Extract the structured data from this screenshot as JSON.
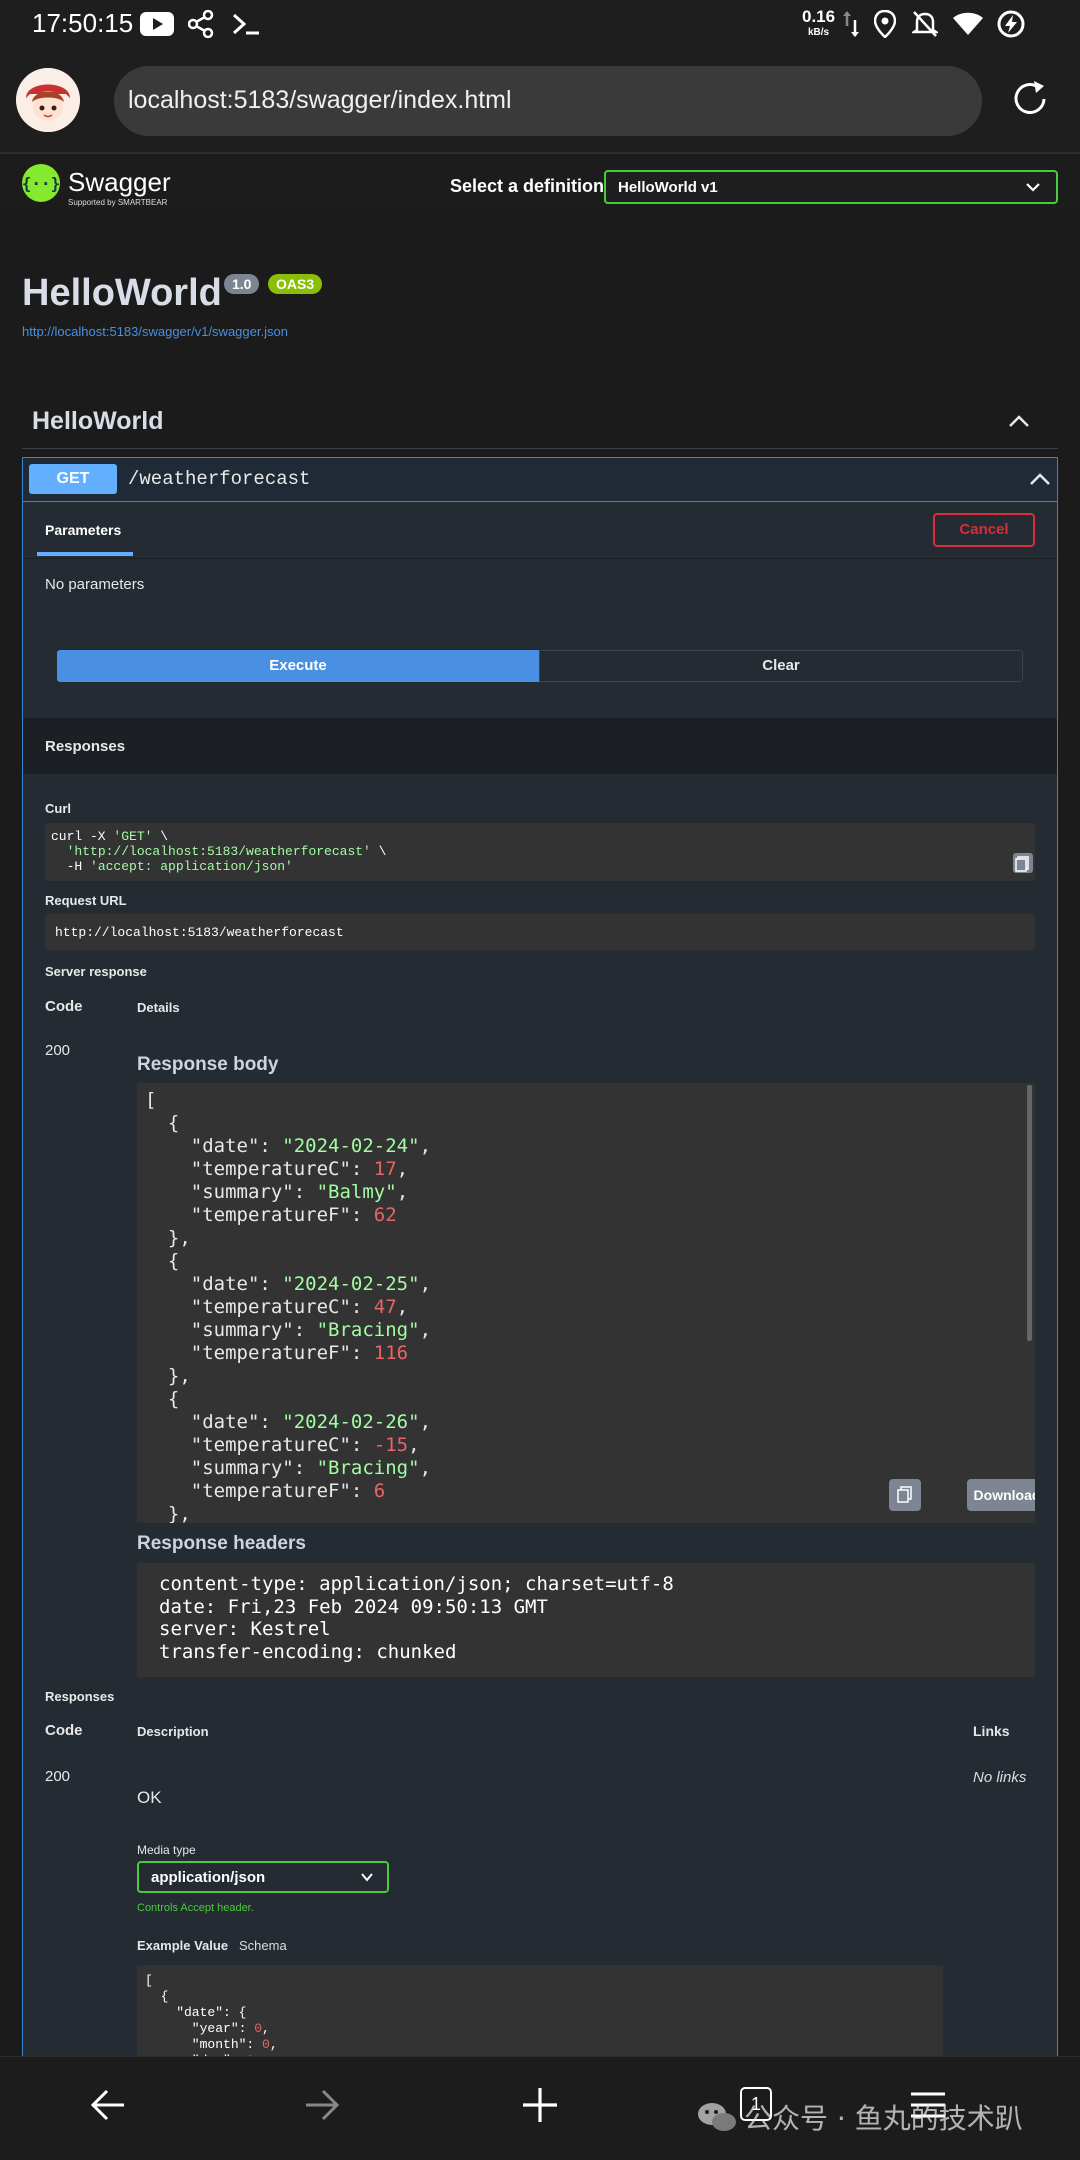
{
  "status": {
    "time": "17:50:15",
    "net_speed": "0.16",
    "net_unit": "kB/s"
  },
  "browser": {
    "url": "localhost:5183/swagger/index.html"
  },
  "swagger": {
    "brand": "Swagger",
    "brand_sub": "Supported by SMARTBEAR",
    "select_label": "Select a definition",
    "selected_definition": "HelloWorld v1",
    "title": "HelloWorld",
    "version_badge": "1.0",
    "oas_badge": "OAS3",
    "spec_link": "http://localhost:5183/swagger/v1/swagger.json",
    "section_title": "HelloWorld"
  },
  "operation": {
    "method": "GET",
    "path": "/weatherforecast",
    "params_tab": "Parameters",
    "cancel": "Cancel",
    "no_params": "No parameters",
    "execute": "Execute",
    "clear": "Clear",
    "responses_header": "Responses",
    "curl_label": "Curl",
    "curl_line1_a": "curl -X ",
    "curl_line1_b": "'GET'",
    "curl_line1_c": " \\",
    "curl_line2": "'http://localhost:5183/weatherforecast'",
    "curl_line2_c": " \\",
    "curl_line3_a": "-H ",
    "curl_line3_b": "'accept: application/json'",
    "request_url_label": "Request URL",
    "request_url": "http://localhost:5183/weatherforecast",
    "server_response_label": "Server response",
    "code_col": "Code",
    "details_col": "Details",
    "code_value": "200",
    "response_body_label": "Response body",
    "download": "Download",
    "response_headers_label": "Response headers",
    "headers": [
      "content-type: application/json; charset=utf-8",
      "date: Fri,23 Feb 2024 09:50:13 GMT",
      "server: Kestrel",
      "transfer-encoding: chunked"
    ],
    "responses_label2": "Responses",
    "code_col2": "Code",
    "description_col": "Description",
    "links_col": "Links",
    "code_value2": "200",
    "no_links": "No links",
    "ok": "OK",
    "media_type_label": "Media type",
    "media_type": "application/json",
    "controls_accept": "Controls Accept header.",
    "example_value_tab": "Example Value",
    "schema_tab": "Schema"
  },
  "response_body": [
    {
      "date": "2024-02-24",
      "temperatureC": "17",
      "summary": "Balmy",
      "temperatureF": "62"
    },
    {
      "date": "2024-02-25",
      "temperatureC": "47",
      "summary": "Bracing",
      "temperatureF": "116"
    },
    {
      "date": "2024-02-26",
      "temperatureC": "-15",
      "summary": "Bracing",
      "temperatureF": "6"
    }
  ],
  "watermark": "公众号 · 鱼丸的技术趴",
  "tab_count": "1",
  "colors": {
    "get_blue": "#61affe",
    "execute_blue": "#4990e2",
    "cancel_red": "#d82c3a",
    "green": "#49cc39",
    "panel_bg": "#242b33"
  }
}
